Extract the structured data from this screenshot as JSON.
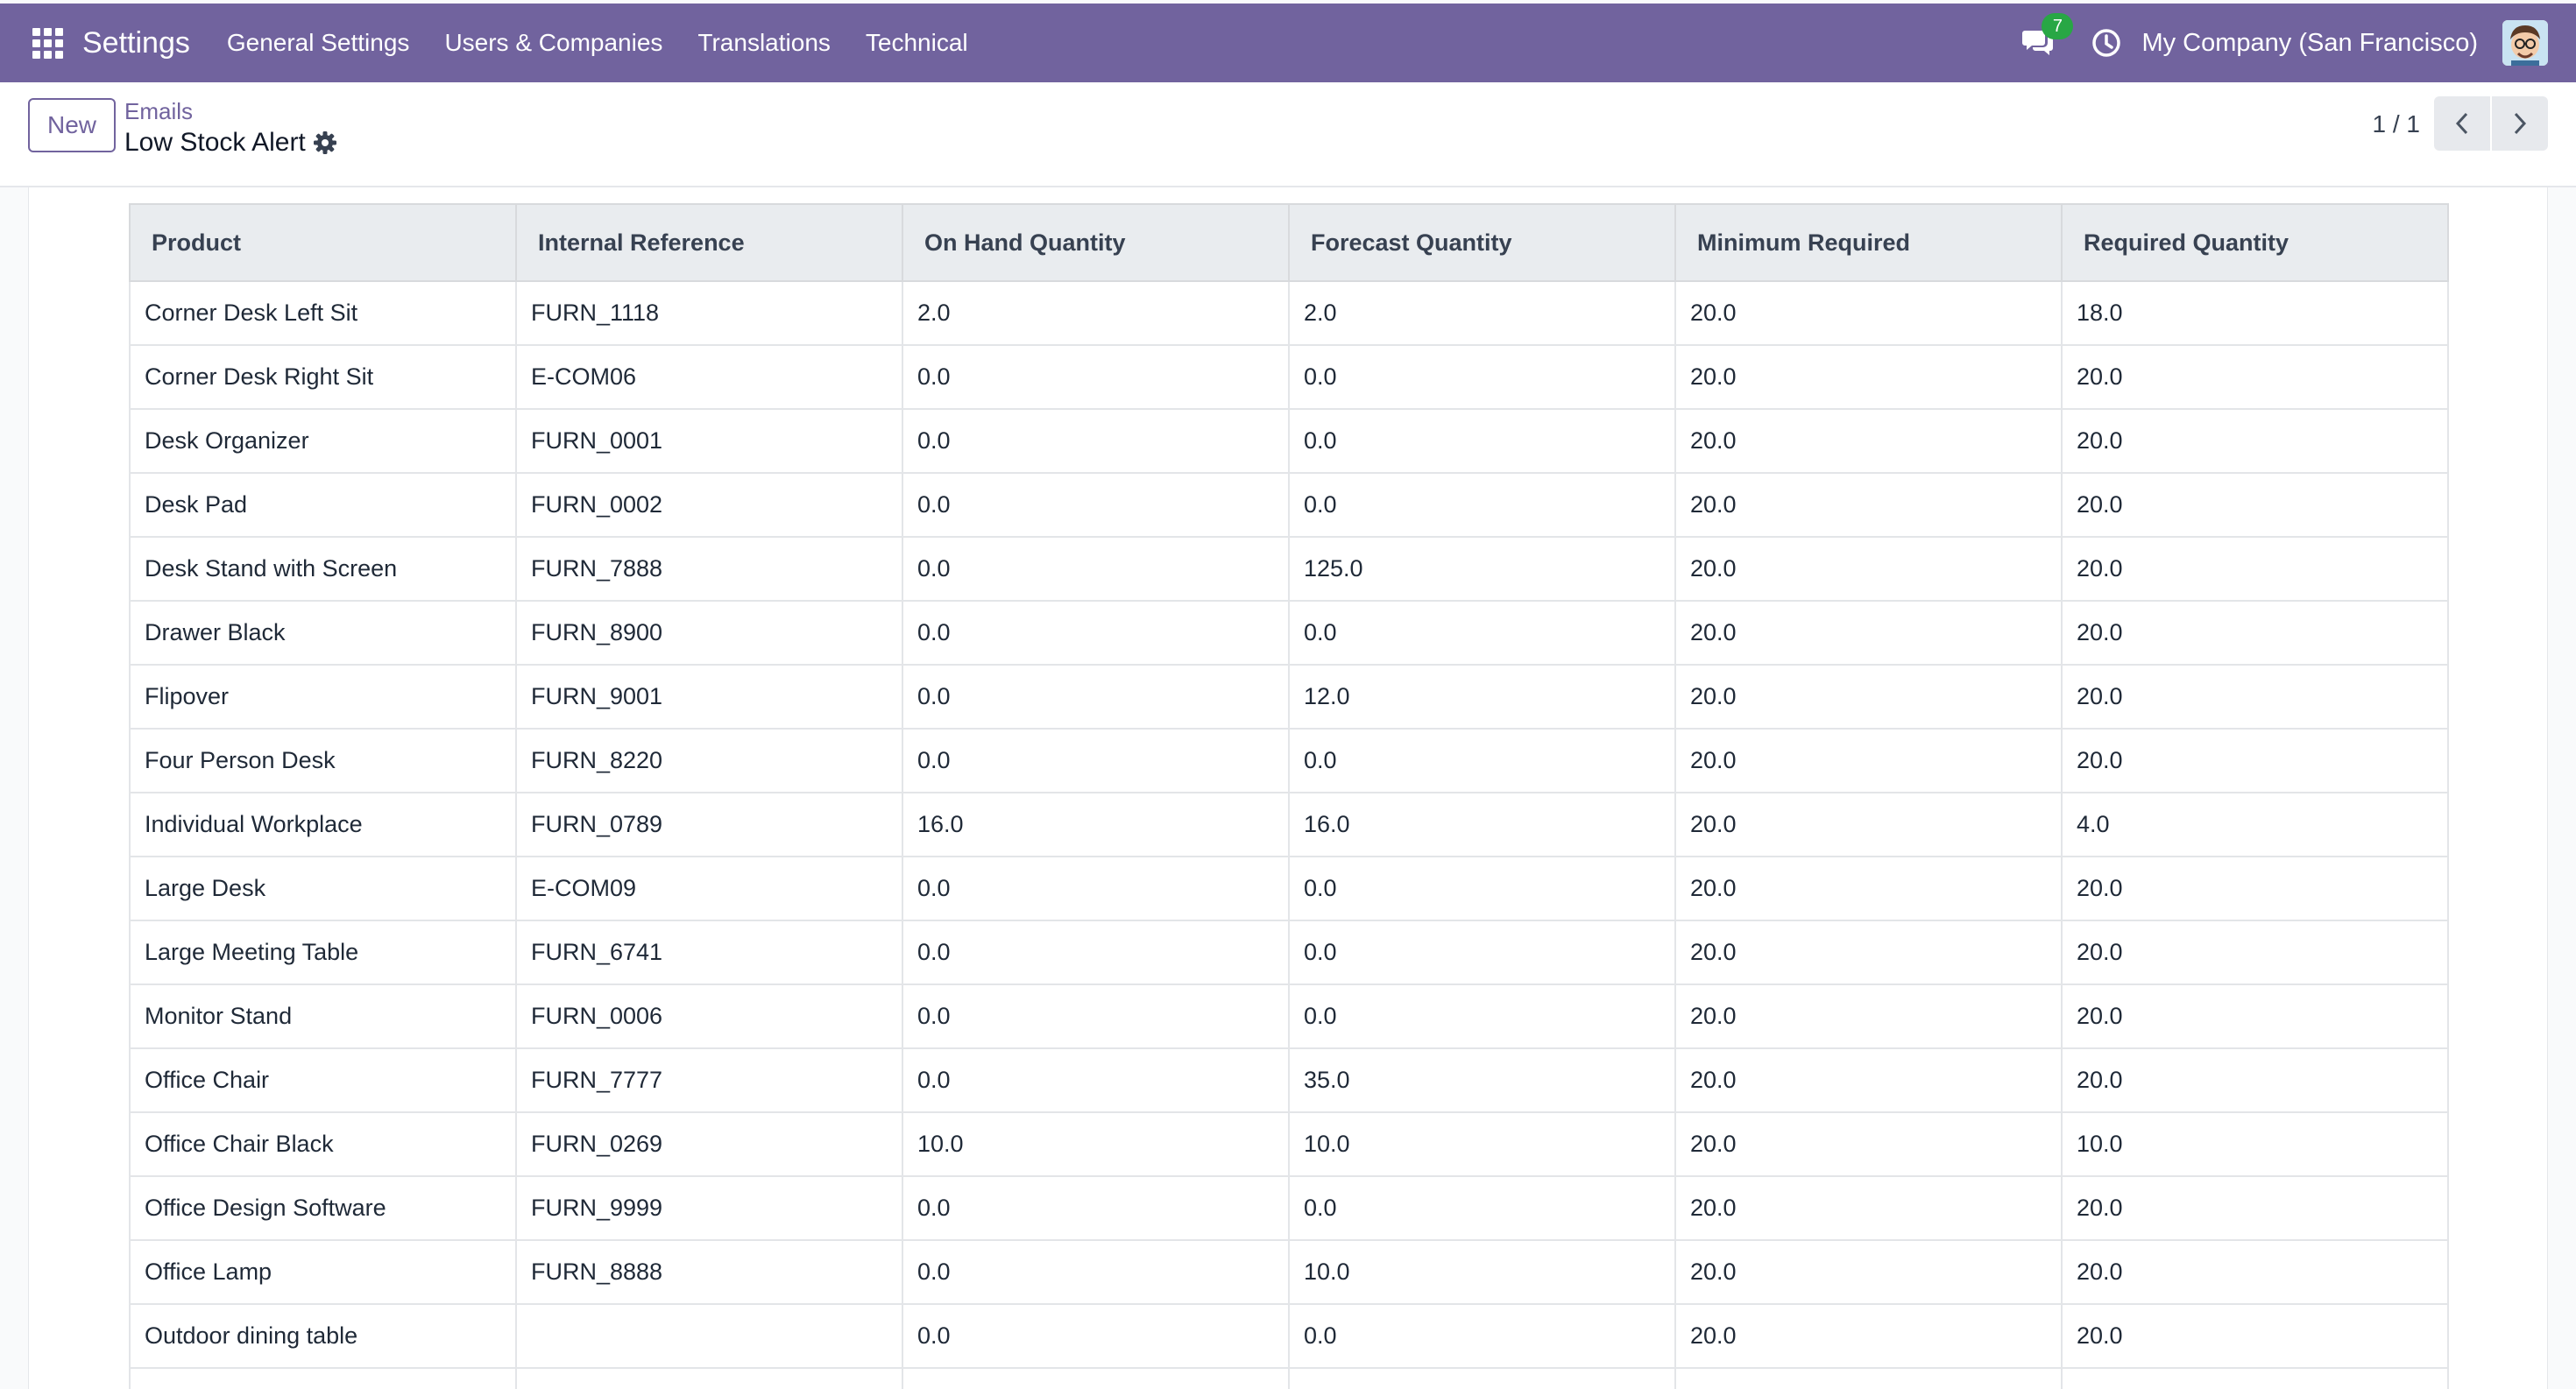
{
  "navbar": {
    "brand": "Settings",
    "menu": [
      "General Settings",
      "Users & Companies",
      "Translations",
      "Technical"
    ],
    "chat_count": "7",
    "company": "My Company (San Francisco)"
  },
  "control": {
    "new_label": "New",
    "breadcrumb": "Emails",
    "record_title": "Low Stock Alert",
    "pager": "1 / 1"
  },
  "table": {
    "headers": [
      "Product",
      "Internal Reference",
      "On Hand Quantity",
      "Forecast Quantity",
      "Minimum Required",
      "Required Quantity"
    ],
    "rows": [
      [
        "Corner Desk Left Sit",
        "FURN_1118",
        "2.0",
        "2.0",
        "20.0",
        "18.0"
      ],
      [
        "Corner Desk Right Sit",
        "E-COM06",
        "0.0",
        "0.0",
        "20.0",
        "20.0"
      ],
      [
        "Desk Organizer",
        "FURN_0001",
        "0.0",
        "0.0",
        "20.0",
        "20.0"
      ],
      [
        "Desk Pad",
        "FURN_0002",
        "0.0",
        "0.0",
        "20.0",
        "20.0"
      ],
      [
        "Desk Stand with Screen",
        "FURN_7888",
        "0.0",
        "125.0",
        "20.0",
        "20.0"
      ],
      [
        "Drawer Black",
        "FURN_8900",
        "0.0",
        "0.0",
        "20.0",
        "20.0"
      ],
      [
        "Flipover",
        "FURN_9001",
        "0.0",
        "12.0",
        "20.0",
        "20.0"
      ],
      [
        "Four Person Desk",
        "FURN_8220",
        "0.0",
        "0.0",
        "20.0",
        "20.0"
      ],
      [
        "Individual Workplace",
        "FURN_0789",
        "16.0",
        "16.0",
        "20.0",
        "4.0"
      ],
      [
        "Large Desk",
        "E-COM09",
        "0.0",
        "0.0",
        "20.0",
        "20.0"
      ],
      [
        "Large Meeting Table",
        "FURN_6741",
        "0.0",
        "0.0",
        "20.0",
        "20.0"
      ],
      [
        "Monitor Stand",
        "FURN_0006",
        "0.0",
        "0.0",
        "20.0",
        "20.0"
      ],
      [
        "Office Chair",
        "FURN_7777",
        "0.0",
        "35.0",
        "20.0",
        "20.0"
      ],
      [
        "Office Chair Black",
        "FURN_0269",
        "10.0",
        "10.0",
        "20.0",
        "10.0"
      ],
      [
        "Office Design Software",
        "FURN_9999",
        "0.0",
        "0.0",
        "20.0",
        "20.0"
      ],
      [
        "Office Lamp",
        "FURN_8888",
        "0.0",
        "10.0",
        "20.0",
        "20.0"
      ],
      [
        "Outdoor dining table",
        "",
        "0.0",
        "0.0",
        "20.0",
        "20.0"
      ],
      [
        "",
        "",
        "",
        "",
        "",
        ""
      ]
    ]
  }
}
